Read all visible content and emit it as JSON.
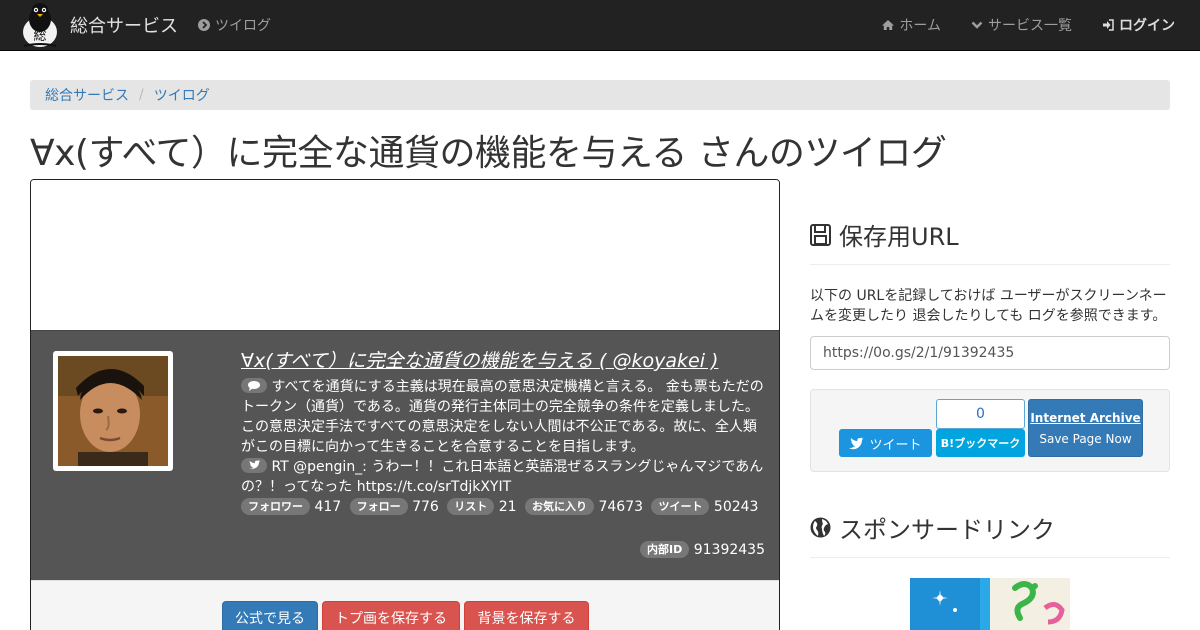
{
  "navbar": {
    "brand": "総合サービス",
    "logo_char": "総",
    "tweetlog": "ツイログ",
    "home": "ホーム",
    "services": "サービス一覧",
    "login": "ログイン"
  },
  "breadcrumb": [
    "総合サービス",
    "ツイログ"
  ],
  "page_title": "∀x(すべて）に完全な通貨の機能を与える さんのツイログ",
  "profile": {
    "name_link": "∀x(すべて）に完全な通貨の機能を与える ( @koyakei )",
    "bio": "すべてを通貨にする主義は現在最高の意思決定機構と言える。 金も票もただのトークン（通貨）である。通貨の発行主体同士の完全競争の条件を定義しました。この意思決定手法ですべての意思決定をしない人間は不公正である。故に、全人類がこの目標に向かって生きることを合意することを目指します。",
    "latest_tweet": "RT @pengin_: うわー！！これ日本語と英語混ぜるスラングじゃんマジであんの？！ってなった https://t.co/srTdjkXYIT",
    "stats": [
      {
        "label": "フォロワー",
        "value": "417"
      },
      {
        "label": "フォロー",
        "value": "776"
      },
      {
        "label": "リスト",
        "value": "21"
      },
      {
        "label": "お気に入り",
        "value": "74673"
      },
      {
        "label": "ツイート",
        "value": "50243"
      }
    ],
    "internal_id_label": "内部ID",
    "internal_id": "91392435"
  },
  "actions": {
    "official": "公式で見る",
    "save_top": "トプ画を保存する",
    "save_bg": "背景を保存する"
  },
  "sidebar": {
    "save_url_heading": "保存用URL",
    "save_url_desc": "以下の URLを記録しておけば ユーザーがスクリーンネームを変更したり 退会したりしても ログを参照できます。",
    "save_url": "https://0o.gs/2/1/91392435",
    "tweet_button": "ツイート",
    "hatena_count": "0",
    "hatena_button": "B!ブックマーク",
    "ia_title": "Internet Archive",
    "ia_sub": "Save Page Now",
    "sponsor_heading": "スポンサードリンク"
  },
  "colors": {
    "navbar": "#222222",
    "profile_bg": "#555555",
    "primary": "#337ab7",
    "danger": "#d9534f",
    "twitter": "#1b95e0",
    "hatena": "#00a4de"
  }
}
